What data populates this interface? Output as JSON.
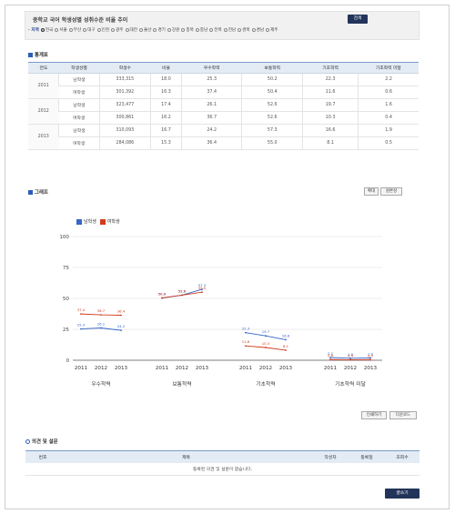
{
  "page_title": "중학교 국어 학생성별 성취수준 비율 추이",
  "region": {
    "label": "· 지역",
    "options": [
      "전국",
      "서울",
      "부산",
      "대구",
      "인천",
      "광주",
      "대전",
      "울산",
      "경기",
      "강원",
      "충북",
      "충남",
      "전북",
      "전남",
      "경북",
      "경남",
      "제주"
    ],
    "selected": "전국",
    "search_label": "검색"
  },
  "stats": {
    "heading": "통계표",
    "columns": [
      "연도",
      "학생성별",
      "학생수",
      "비율",
      "우수학력",
      "보통학력",
      "기초학력",
      "기초학력 미달"
    ],
    "rows": [
      {
        "year": "2011",
        "gender": "남학생",
        "count": "333,315",
        "ratio": "18.0",
        "excellent": "25.3",
        "normal": "50.2",
        "basic": "22.3",
        "below": "2.2"
      },
      {
        "year": "",
        "gender": "여학생",
        "count": "301,392",
        "ratio": "16.3",
        "excellent": "37.4",
        "normal": "50.4",
        "basic": "11.6",
        "below": "0.6"
      },
      {
        "year": "2012",
        "gender": "남학생",
        "count": "323,477",
        "ratio": "17.4",
        "excellent": "26.1",
        "normal": "52.6",
        "basic": "19.7",
        "below": "1.6"
      },
      {
        "year": "",
        "gender": "여학생",
        "count": "300,861",
        "ratio": "16.2",
        "excellent": "36.7",
        "normal": "52.6",
        "basic": "10.3",
        "below": "0.4"
      },
      {
        "year": "2013",
        "gender": "남학생",
        "count": "310,093",
        "ratio": "16.7",
        "excellent": "24.2",
        "normal": "57.3",
        "basic": "16.6",
        "below": "1.9"
      },
      {
        "year": "",
        "gender": "여학생",
        "count": "284,086",
        "ratio": "15.3",
        "excellent": "36.4",
        "normal": "55.0",
        "basic": "8.1",
        "below": "0.5"
      }
    ]
  },
  "graph": {
    "heading": "그래프",
    "zoom_in_label": "확대",
    "reset_label": "원론성",
    "print_label": "인쇄하기",
    "download_label": "다운로드"
  },
  "colors": {
    "male": "#3565c8",
    "female": "#d23a1c",
    "accent": "#23345a"
  },
  "chart_data": {
    "type": "line",
    "groups": [
      "우수학력",
      "보통학력",
      "기초학력",
      "기초학력 미달"
    ],
    "x": [
      "2011",
      "2012",
      "2013"
    ],
    "ylim": [
      0,
      100
    ],
    "yticks": [
      0,
      25,
      50,
      75,
      100
    ],
    "series": [
      {
        "name": "남학생",
        "values": [
          [
            25.3,
            26.1,
            24.2
          ],
          [
            50.2,
            52.6,
            57.3
          ],
          [
            22.3,
            19.7,
            16.6
          ],
          [
            2.2,
            1.6,
            1.9
          ]
        ]
      },
      {
        "name": "여학생",
        "values": [
          [
            37.4,
            36.7,
            36.4
          ],
          [
            50.4,
            52.6,
            55.0
          ],
          [
            11.6,
            10.3,
            8.1
          ],
          [
            0.6,
            0.4,
            0.5
          ]
        ]
      }
    ]
  },
  "opinion": {
    "heading": "의견 및 설문",
    "columns": [
      "번호",
      "제목",
      "작성자",
      "등록일",
      "조회수"
    ],
    "empty_message": "등록된 의견 및 설문이 없습니다.",
    "write_label": "글쓰기"
  }
}
